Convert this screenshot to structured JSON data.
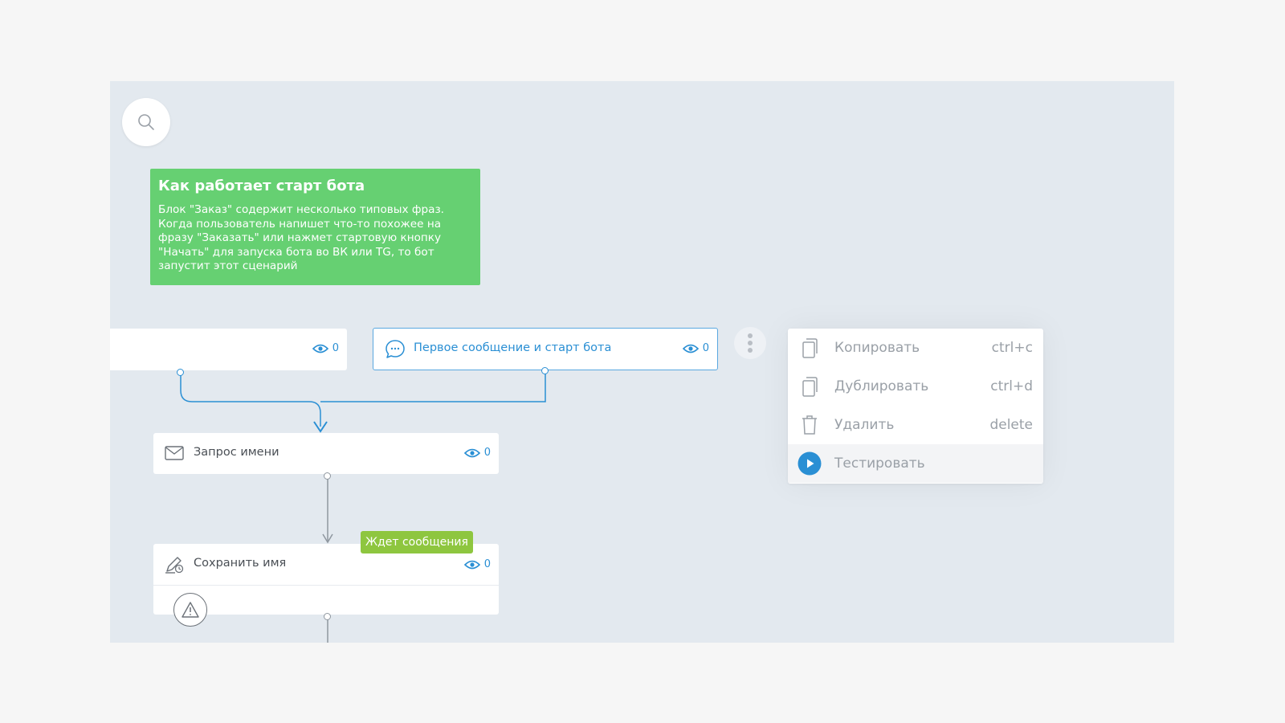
{
  "note": {
    "title": "Как работает старт бота",
    "text": "Блок \"Заказ\" содержит несколько типовых фраз. Когда пользователь напишет что-то похожее на фразу \"Заказать\" или нажмет стартовую кнопку \"Начать\" для запуска бота во ВК или TG, то бот запустит этот сценарий"
  },
  "blocks": {
    "left": {
      "views": "0"
    },
    "first": {
      "label": "Первое сообщение и старт бота",
      "views": "0"
    },
    "name_request": {
      "label": "Запрос имени",
      "views": "0"
    },
    "save_name": {
      "label": "Сохранить имя",
      "views": "0",
      "badge": "Ждет сообщения"
    }
  },
  "menu": {
    "items": [
      {
        "label": "Копировать",
        "shortcut": "ctrl+c",
        "icon": "copy-icon"
      },
      {
        "label": "Дублировать",
        "shortcut": "ctrl+d",
        "icon": "duplicate-icon"
      },
      {
        "label": "Удалить",
        "shortcut": "delete",
        "icon": "trash-icon"
      },
      {
        "label": "Тестировать",
        "shortcut": "",
        "icon": "play-icon"
      }
    ]
  },
  "colors": {
    "canvas": "#e3e9ef",
    "note": "#66d072",
    "accent": "#2a8fd4",
    "badge": "#8ec63f"
  }
}
